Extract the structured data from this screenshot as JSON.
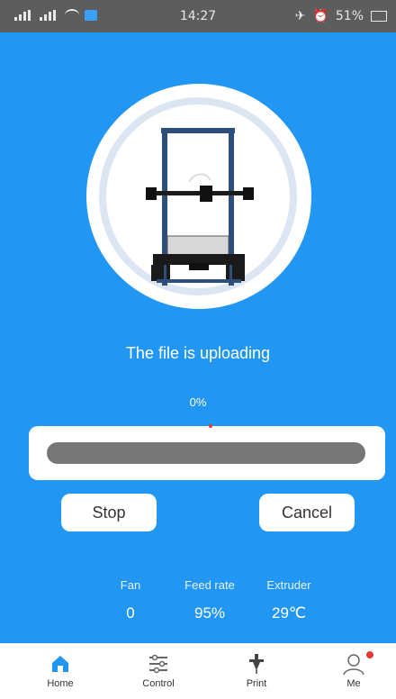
{
  "status": {
    "time": "14:27",
    "battery": "51%"
  },
  "upload": {
    "message": "The file is uploading",
    "percent_label": "0%",
    "progress": 0.0
  },
  "buttons": {
    "stop": "Stop",
    "cancel": "Cancel"
  },
  "stats": {
    "fan": {
      "label": "Fan",
      "value": "0"
    },
    "feed_rate": {
      "label": "Feed rate",
      "value": "95%"
    },
    "extruder": {
      "label": "Extruder",
      "value": "29℃"
    }
  },
  "nav": [
    {
      "label": "Home",
      "icon": "home-icon",
      "active": true
    },
    {
      "label": "Control",
      "icon": "sliders-icon"
    },
    {
      "label": "Print",
      "icon": "nozzle-icon"
    },
    {
      "label": "Me",
      "icon": "user-icon"
    }
  ],
  "colors": {
    "accent": "#2196f3",
    "track": "#777777",
    "badge": "#e53935"
  }
}
